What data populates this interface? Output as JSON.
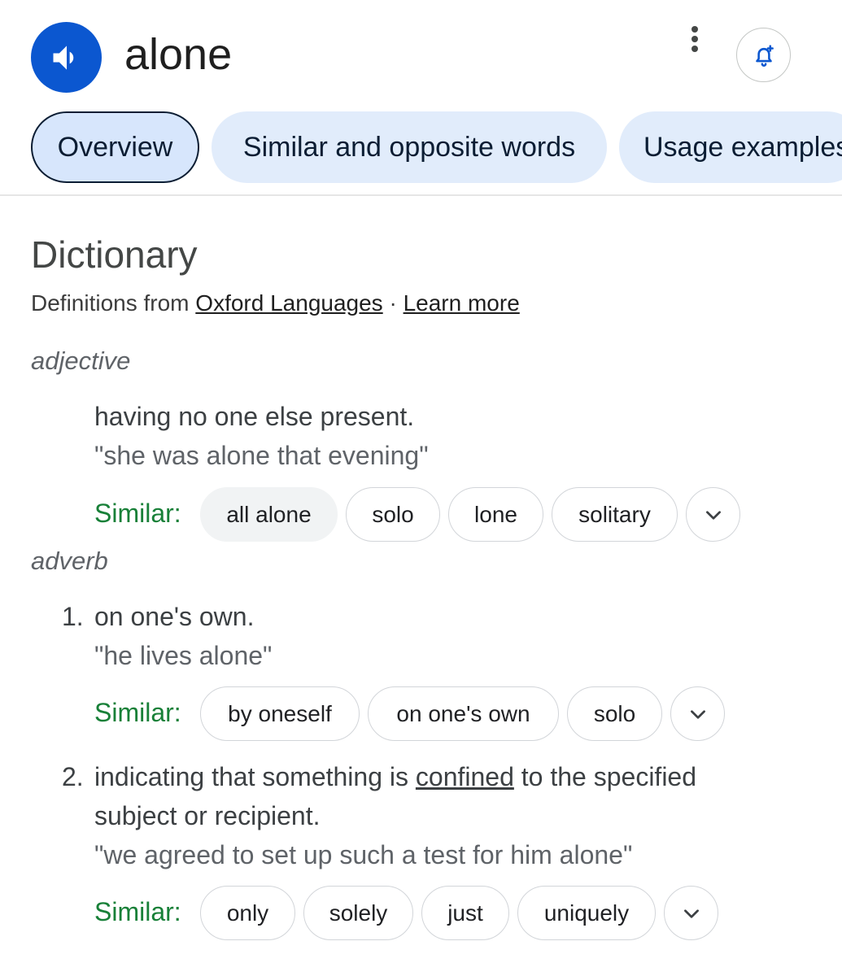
{
  "header": {
    "word": "alone",
    "speaker_icon": "speaker-icon",
    "menu_icon": "more-vert-icon",
    "alert_icon": "bell-add-icon"
  },
  "tabs": [
    {
      "label": "Overview",
      "active": true
    },
    {
      "label": "Similar and opposite words",
      "active": false
    },
    {
      "label": "Usage examples",
      "active": false
    }
  ],
  "dictionary": {
    "title": "Dictionary",
    "source_prefix": "Definitions from ",
    "source_link": "Oxford Languages",
    "separator": " · ",
    "learn_more": "Learn more"
  },
  "entries": {
    "adjective": {
      "pos": "adjective",
      "definition": "having no one else present.",
      "example": "\"she was alone that evening\"",
      "similar_label": "Similar:",
      "similar": [
        "all alone",
        "solo",
        "lone",
        "solitary"
      ]
    },
    "adverb": {
      "pos": "adverb",
      "senses": [
        {
          "number": "1.",
          "definition": "on one's own.",
          "example": "\"he lives alone\"",
          "similar_label": "Similar:",
          "similar": [
            "by oneself",
            "on one's own",
            "solo"
          ]
        },
        {
          "number": "2.",
          "definition_before": "indicating that something is ",
          "definition_link": "confined",
          "definition_after": " to the specified",
          "definition_line2": "subject or recipient.",
          "example": "\"we agreed to set up such a test for him alone\"",
          "similar_label": "Similar:",
          "similar": [
            "only",
            "solely",
            "just",
            "uniquely"
          ]
        }
      ]
    }
  },
  "colors": {
    "accent_blue": "#0b57d0",
    "tab_bg": "#e1ecfb",
    "similar_green": "#188038"
  }
}
